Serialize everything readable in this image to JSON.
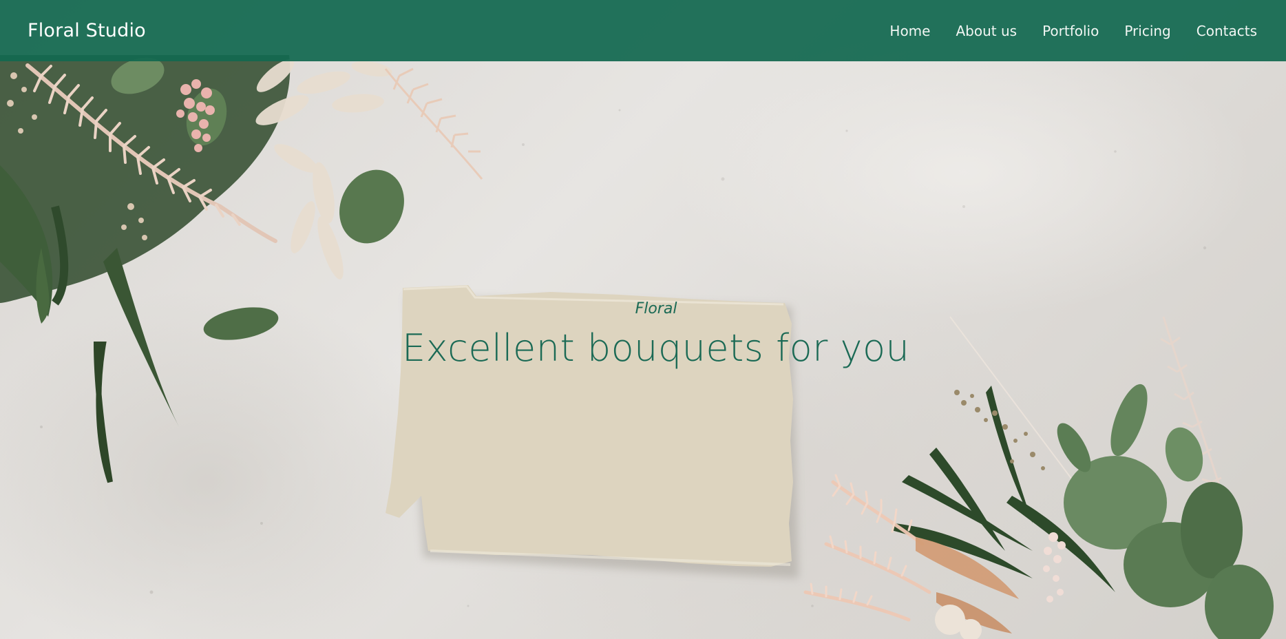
{
  "header": {
    "brand": "Floral Studio",
    "nav": [
      {
        "label": "Home"
      },
      {
        "label": "About us"
      },
      {
        "label": "Portfolio"
      },
      {
        "label": "Pricing"
      },
      {
        "label": "Contacts"
      }
    ]
  },
  "hero": {
    "eyebrow": "Floral",
    "headline": "Excellent bouquets for you",
    "background_image": "flat-lay-dried-flowers-paper-note"
  },
  "colors": {
    "header_bg": "#126850",
    "accent_text": "#1b6a55",
    "nav_text": "#f1f6f3",
    "paper": "#ddd4bf"
  }
}
